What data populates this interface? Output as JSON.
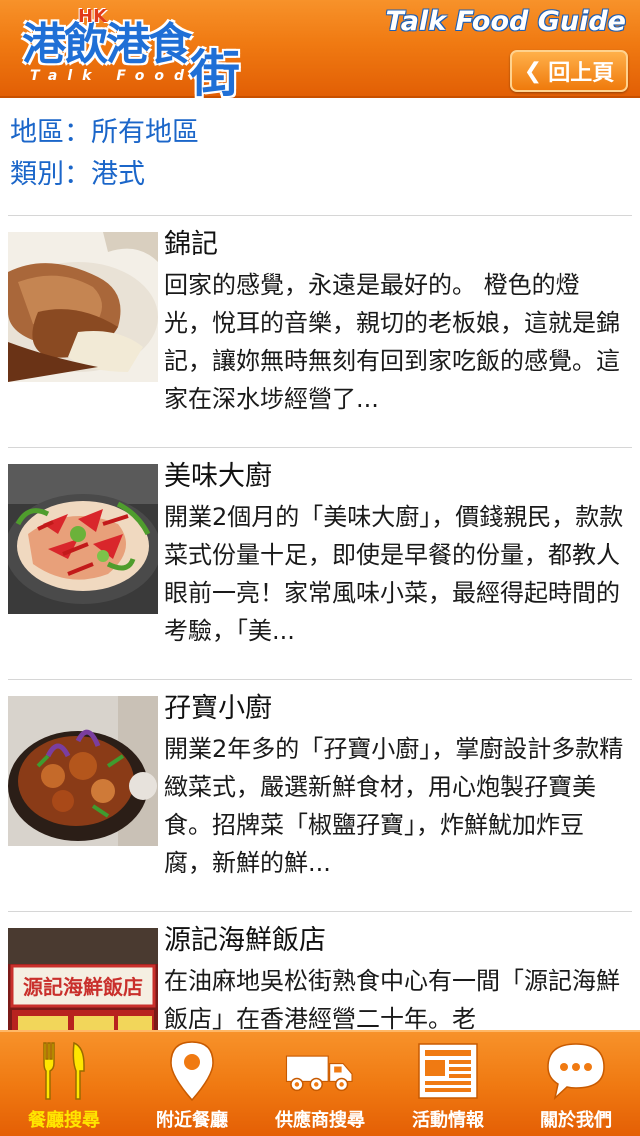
{
  "header": {
    "logo_main": "港飲港食",
    "logo_hk": "HK",
    "logo_sub": "Talk Food",
    "logo_street": "街",
    "app_title": "Talk Food Guide",
    "back_label": "回上頁"
  },
  "filters": {
    "region": "地區：所有地區",
    "category": "類別：港式"
  },
  "restaurants": [
    {
      "name": "錦記",
      "description": "回家的感覺，永遠是最好的。 橙色的燈光，悅耳的音樂，親切的老板娘，這就是錦記，讓妳無時無刻有回到家吃飯的感覺。這家在深水埗經營了..."
    },
    {
      "name": "美味大廚",
      "description": "開業2個月的「美味大廚」，價錢親民，款款菜式份量十足，即使是早餐的份量，都教人眼前一亮！家常風味小菜，最經得起時間的考驗，「美..."
    },
    {
      "name": "孖寶小廚",
      "description": "開業2年多的「孖寶小廚」，掌廚設計多款精緻菜式，嚴選新鮮食材，用心炮製孖寶美食。招牌菜「椒鹽孖寶」，炸鮮魷加炸豆腐，新鮮的鮮..."
    },
    {
      "name": "源記海鮮飯店",
      "description": "在油麻地吳松街熟食中心有一間「源記海鮮飯店」在香港經營二十年。老",
      "sign_text": "源記海鮮飯店"
    }
  ],
  "tabs": [
    {
      "label": "餐廳搜尋",
      "icon": "fork-knife-icon",
      "active": true
    },
    {
      "label": "附近餐廳",
      "icon": "map-pin-icon",
      "active": false
    },
    {
      "label": "供應商搜尋",
      "icon": "truck-icon",
      "active": false
    },
    {
      "label": "活動情報",
      "icon": "newspaper-icon",
      "active": false
    },
    {
      "label": "關於我們",
      "icon": "chat-bubble-icon",
      "active": false
    }
  ],
  "colors": {
    "brand_orange": "#f07a12",
    "link_blue": "#1b66c9",
    "active_tab": "#ffe600"
  }
}
